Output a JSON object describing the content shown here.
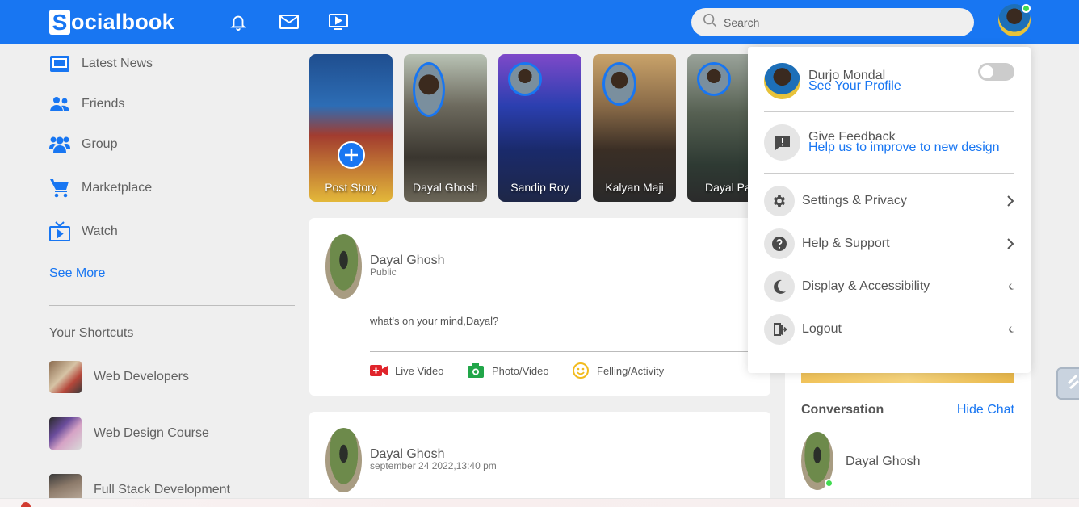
{
  "nav": {
    "logo_letter": "S",
    "logo_rest": "ocialbook",
    "icons": [
      "bell-icon",
      "mail-icon",
      "video-icon"
    ],
    "search_placeholder": "Search"
  },
  "sidebar": {
    "items": [
      {
        "label": "Latest News",
        "icon": "news-icon"
      },
      {
        "label": "Friends",
        "icon": "friends-icon"
      },
      {
        "label": "Group",
        "icon": "group-icon"
      },
      {
        "label": "Marketplace",
        "icon": "cart-icon"
      },
      {
        "label": "Watch",
        "icon": "tv-icon"
      }
    ],
    "see_more": "See More",
    "shortcuts_title": "Your Shortcuts",
    "shortcuts": [
      {
        "label": "Web Developers"
      },
      {
        "label": "Web Design Course"
      },
      {
        "label": "Full Stack Development"
      }
    ]
  },
  "stories": [
    {
      "name": "Post Story"
    },
    {
      "name": "Dayal Ghosh"
    },
    {
      "name": "Sandip Roy"
    },
    {
      "name": "Kalyan Maji"
    },
    {
      "name": "Dayal Pa"
    }
  ],
  "create_post": {
    "user_name": "Dayal Ghosh",
    "privacy": "Public",
    "prompt": "what's on your mind,Dayal?",
    "actions": [
      {
        "label": "Live Video",
        "icon": "live-video-icon"
      },
      {
        "label": "Photo/Video",
        "icon": "camera-icon"
      },
      {
        "label": "Felling/Activity",
        "icon": "smile-icon"
      }
    ]
  },
  "post": {
    "user_name": "Dayal Ghosh",
    "timestamp": "september 24 2022,13:40 pm"
  },
  "right": {
    "conversation_title": "Conversation",
    "hide_chat": "Hide Chat",
    "chat_user": "Dayal Ghosh"
  },
  "dropdown": {
    "profile_name": "Durjo Mondal",
    "profile_link": "See Your Profile",
    "feedback_title": "Give Feedback",
    "feedback_link": "Help us to improve to new design",
    "menu": [
      {
        "label": "Settings & Privacy",
        "icon": "gear-icon"
      },
      {
        "label": "Help & Support",
        "icon": "help-icon"
      },
      {
        "label": "Display & Accessibility",
        "icon": "moon-icon"
      },
      {
        "label": "Logout",
        "icon": "logout-icon"
      }
    ]
  },
  "colors": {
    "brand": "#1876f2",
    "background": "#efefef",
    "online": "#41db51"
  }
}
